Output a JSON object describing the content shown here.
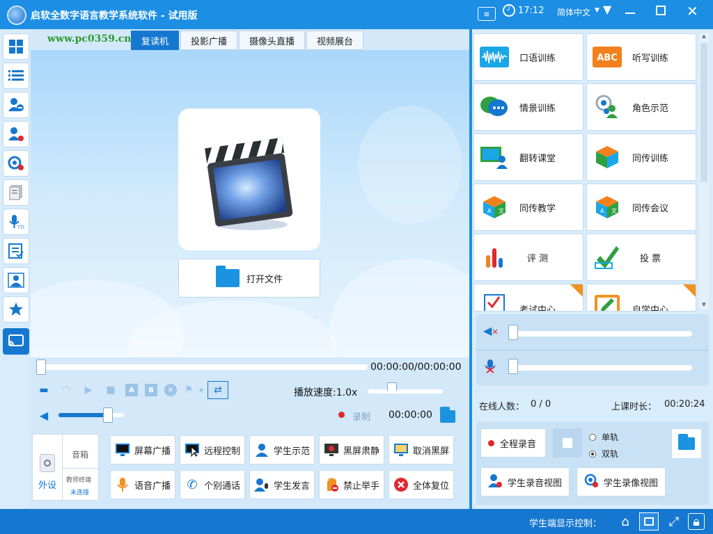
{
  "window": {
    "title": "启软全数字语言教学系统软件 - 试用版",
    "time": "17:12",
    "language": "简体中文",
    "watermark": "www.pc0359.cn"
  },
  "tabs": [
    "复读机",
    "投影广播",
    "摄像头直播",
    "视频展台"
  ],
  "player": {
    "open_file": "打开文件",
    "time_display": "00:00:00/00:00:00",
    "speed_label": "播放速度:1.0x",
    "record_label": "录制",
    "record_time": "00:00:00",
    "progress": 0.0,
    "volume": 0.72
  },
  "speaker_panel": {
    "title": "外设",
    "speaker": "音箱",
    "teacher": "教师终端",
    "status": "未连接"
  },
  "grid_buttons": [
    {
      "label": "屏幕广播",
      "icon": "monitor-icon"
    },
    {
      "label": "远程控制",
      "icon": "remote-control-icon"
    },
    {
      "label": "学生示范",
      "icon": "student-demo-icon"
    },
    {
      "label": "黑屏肃静",
      "icon": "black-screen-icon"
    },
    {
      "label": "取消黑屏",
      "icon": "cancel-black-screen-icon"
    },
    {
      "label": "语音广播",
      "icon": "microphone-icon"
    },
    {
      "label": "个别通话",
      "icon": "phone-icon"
    },
    {
      "label": "学生发言",
      "icon": "student-speak-icon"
    },
    {
      "label": "禁止举手",
      "icon": "no-hand-raise-icon"
    },
    {
      "label": "全体复位",
      "icon": "reset-all-icon"
    }
  ],
  "features": [
    {
      "label": "口语训练",
      "icon": "waveform-icon"
    },
    {
      "label": "听写训练",
      "icon": "abc-icon"
    },
    {
      "label": "情景训练",
      "icon": "chat-bubble-icon"
    },
    {
      "label": "角色示范",
      "icon": "role-icon"
    },
    {
      "label": "翻转课堂",
      "icon": "flip-classroom-icon"
    },
    {
      "label": "同传训练",
      "icon": "cube-icon"
    },
    {
      "label": "同传教学",
      "icon": "translate-cube-icon"
    },
    {
      "label": "同传会议",
      "icon": "translate-cube-icon"
    },
    {
      "label": "评 测",
      "icon": "bar-chart-icon"
    },
    {
      "label": "投 票",
      "icon": "checkmark-icon"
    },
    {
      "label": "考试中心",
      "icon": "exam-icon"
    },
    {
      "label": "自学中心",
      "icon": "self-study-icon"
    }
  ],
  "status": {
    "online_label": "在线人数：",
    "online_value": "0 / 0",
    "duration_label": "上课时长：",
    "duration_value": "00:20:24"
  },
  "audio": {
    "speaker_volume": 0.0,
    "mic_volume": 0.0
  },
  "recording": {
    "full_record": "全程录音",
    "single_track": "单轨",
    "dual_track": "双轨",
    "selected_track": "双轨",
    "student_audio_view": "学生录音视图",
    "student_video_view": "学生录像视图"
  },
  "footer": {
    "label": "学生端显示控制："
  },
  "colors": {
    "brand_blue": "#1c8ee3",
    "active_blue": "#1577cf",
    "panel_bg": "#d9ecfb",
    "record_red": "#e0282e"
  }
}
